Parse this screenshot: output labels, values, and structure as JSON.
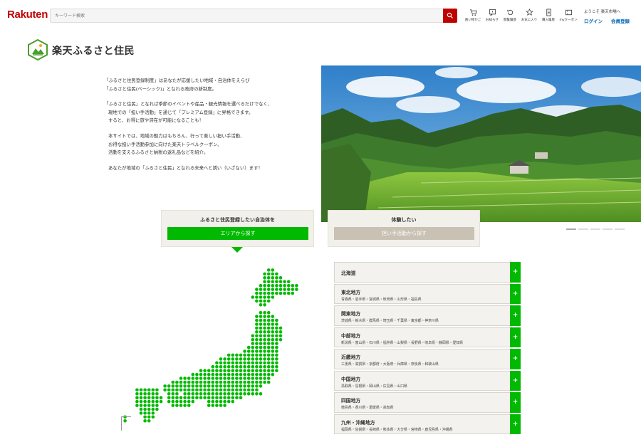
{
  "header": {
    "logo": "Rakuten",
    "search_placeholder": "キーワード検索",
    "nav": [
      {
        "icon": "cart-icon",
        "label": "買い物かご"
      },
      {
        "icon": "notice-icon",
        "label": "お知らせ"
      },
      {
        "icon": "history-icon",
        "label": "閲覧履歴"
      },
      {
        "icon": "star-icon",
        "label": "お気に入り"
      },
      {
        "icon": "receipt-icon",
        "label": "購入履歴"
      },
      {
        "icon": "coupon-icon",
        "label": "myクーポン"
      }
    ],
    "welcome": "ようこそ 楽天市場へ",
    "login": "ログイン",
    "register": "会員登録"
  },
  "page": {
    "title": "楽天ふるさと住民"
  },
  "intro": {
    "p1a": "「ふるさと住民登録制度」はあなたが応援したい地域・自治体をえらび",
    "p1b": "「ふるさと住民(ベーシック)」となれる政府の新制度。",
    "p2a": "「ふるさと住民」となれば季節のイベントや産品・観光情報を選べるだけでなく、",
    "p2b": "現地での「担い手活動」を通じて「プレミアム登録」に昇格できます。",
    "p2c": "すると、お得に旅や滞在が可能になることも！",
    "p3a": "本サイトでは、地域の魅力はもちろん、行って楽しい担い手活動、",
    "p3b": "お得な担い手活動参加に向けた楽天トラベルクーポン、",
    "p3c": "活動を支えるふるさと納税の返礼品などを紹介。",
    "p4": "あなたが地域の「ふるさと住民」となれる未来へと誘い（いざない）ます！"
  },
  "cards": {
    "register_label": "ふるさと住民登録したい自治体を",
    "register_button": "エリアから探す",
    "experience_label": "体験したい",
    "experience_button": "担い手活動から探す"
  },
  "regions": [
    {
      "name": "北海道",
      "prefectures": ""
    },
    {
      "name": "東北地方",
      "prefectures": "青森県・岩手県・宮城県・秋田県・山形県・福島県"
    },
    {
      "name": "関東地方",
      "prefectures": "茨城県・栃木県・群馬県・埼玉県・千葉県・東京都・神奈川県"
    },
    {
      "name": "中部地方",
      "prefectures": "新潟県・富山県・石川県・福井県・山梨県・長野県・岐阜県・静岡県・愛知県"
    },
    {
      "name": "近畿地方",
      "prefectures": "三重県・滋賀県・京都府・大阪府・兵庫県・奈良県・和歌山県"
    },
    {
      "name": "中国地方",
      "prefectures": "鳥取県・島根県・岡山県・広島県・山口県"
    },
    {
      "name": "四国地方",
      "prefectures": "徳島県・香川県・愛媛県・高知県"
    },
    {
      "name": "九州・沖縄地方",
      "prefectures": "福岡県・佐賀県・長崎県・熊本県・大分県・宮崎県・鹿児島県・沖縄県"
    }
  ],
  "region_expand_symbol": "+",
  "colors": {
    "brand": "#bf0000",
    "accent_green": "#00b900",
    "link_blue": "#0068b7"
  }
}
